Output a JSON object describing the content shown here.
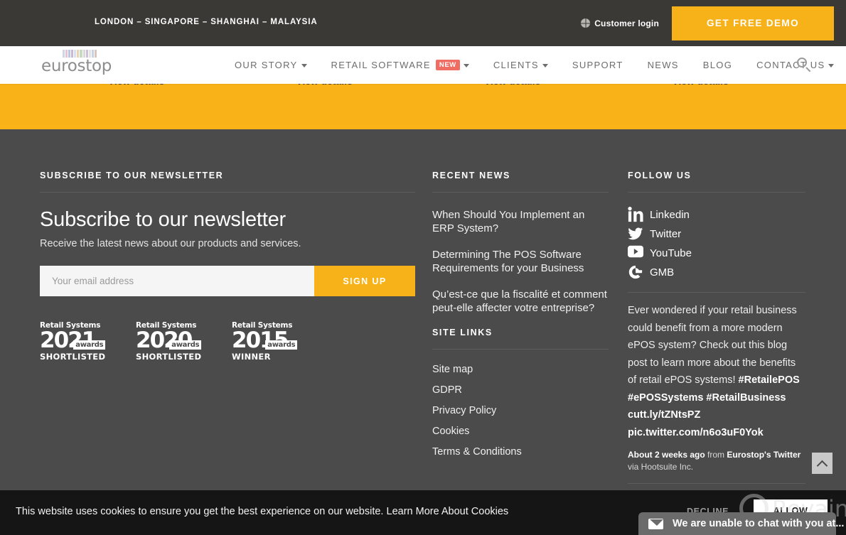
{
  "topbar": {
    "locations": "LONDON – SINGAPORE – SHANGHAI – MALAYSIA",
    "customer_login": "Customer login",
    "demo_button": "GET FREE DEMO",
    "globe_icon": "globe-icon"
  },
  "nav": {
    "logo_word": "eurostop",
    "stripe_colors": [
      "#cfd6e8",
      "#e6c3d6",
      "#b9c8e2",
      "#c9b7d8",
      "#dbe0ef",
      "#e8d4b2",
      "#c7d9c0",
      "#d9d9d9",
      "#cfc0d8",
      "#e3e3e3",
      "#c6d2e6",
      "#d8c7b8"
    ],
    "items": [
      {
        "label": "OUR STORY",
        "has_chevron": true,
        "badge": ""
      },
      {
        "label": "RETAIL SOFTWARE",
        "has_chevron": true,
        "badge": "NEW"
      },
      {
        "label": "CLIENTS",
        "has_chevron": true,
        "badge": ""
      },
      {
        "label": "SUPPORT",
        "has_chevron": false,
        "badge": ""
      },
      {
        "label": "NEWS",
        "has_chevron": false,
        "badge": ""
      },
      {
        "label": "BLOG",
        "has_chevron": false,
        "badge": ""
      },
      {
        "label": "CONTACT US",
        "has_chevron": true,
        "badge": ""
      }
    ],
    "search_icon": "search-icon"
  },
  "product_band": {
    "background": "#f9b217",
    "view_details": [
      "View details",
      "View details",
      "View details",
      "View details"
    ]
  },
  "newsletter": {
    "heading": "SUBSCRIBE TO OUR NEWSLETTER",
    "title": "Subscribe to our newsletter",
    "subtitle": "Receive the latest news about our products and services.",
    "email_placeholder": "Your email address",
    "email_value": "",
    "signup_label": "SIGN UP"
  },
  "awards": [
    {
      "top": "Retail Systems",
      "word": "awards",
      "year": "2021",
      "status": "SHORTLISTED"
    },
    {
      "top": "Retail Systems",
      "word": "awards",
      "year": "2020",
      "status": "SHORTLISTED"
    },
    {
      "top": "Retail Systems",
      "word": "awards",
      "year": "2015",
      "status": "WINNER"
    }
  ],
  "recent_news": {
    "heading": "RECENT NEWS",
    "items": [
      "When Should You Implement an ERP System?",
      "Determining The POS Software Requirements for your Business",
      "Qu’est-ce que la fiscalité et comment peut-elle affecter votre entreprise?"
    ]
  },
  "site_links": {
    "heading": "SITE LINKS",
    "items": [
      "Site map",
      "GDPR",
      "Privacy Policy",
      "Cookies",
      "Terms & Conditions"
    ]
  },
  "follow_us": {
    "heading": "FOLLOW US",
    "socials": [
      {
        "label": "Linkedin",
        "icon": "linkedin-icon"
      },
      {
        "label": "Twitter",
        "icon": "twitter-icon"
      },
      {
        "label": "YouTube",
        "icon": "youtube-icon"
      },
      {
        "label": "GMB",
        "icon": "google-my-business-icon"
      }
    ],
    "tweet_body": "Ever wondered if your retail business could benefit from a more modern ePOS system? Check out this blog post to learn more about the benefits of retail ePOS systems! ",
    "tweet_tags": "#RetailePOS #ePOSSystems #RetailBusiness cutt.ly/tZNtsPZ pic.twitter.com/n6o3uF0Yok",
    "tweet_meta_time": "About 2 weeks ago",
    "tweet_meta_mid": " from ",
    "tweet_meta_source": "Eurostop's Twitter",
    "tweet_meta_end": " via Hootsuite Inc."
  },
  "scroll_top": {
    "icon": "chevron-up-icon"
  },
  "cookie_banner": {
    "text": "This website uses cookies to ensure you get the best experience on our website. ",
    "link": "Learn More About Cookies",
    "decline": "DECLINE",
    "allow": "ALLOW"
  },
  "chat_widget": {
    "label": "We are unable to chat with you at...",
    "icon": "envelope-icon"
  },
  "watermark": {
    "text": "Revain"
  },
  "colors": {
    "accent_yellow": "#f7b219",
    "band_yellow": "#f9b217",
    "footer_grey": "#4b4b4b",
    "topbar_dark": "#3b3936",
    "cookie_black": "#151515",
    "badge_red": "#ef6d63"
  }
}
